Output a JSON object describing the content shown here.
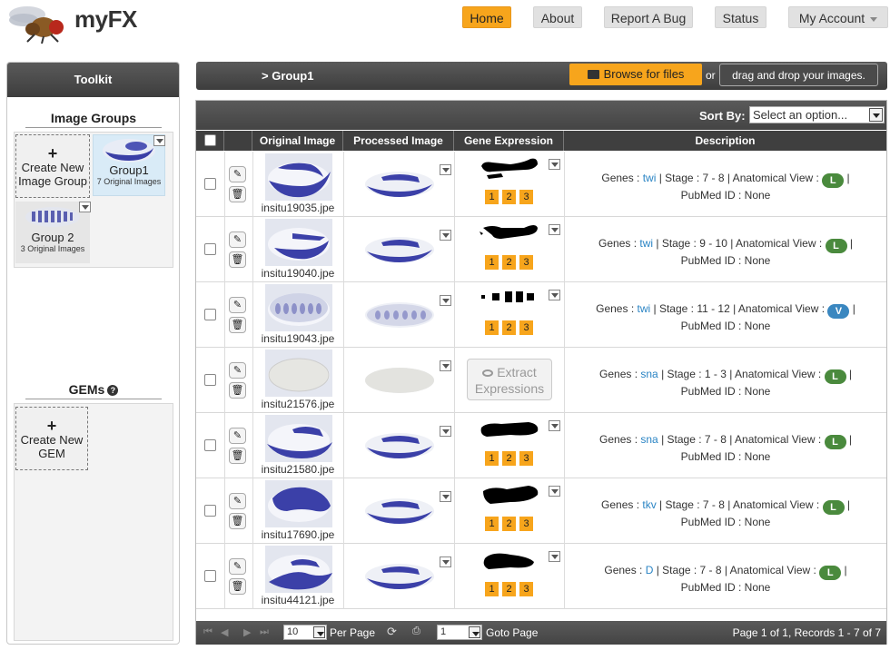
{
  "app": {
    "title": "myFX"
  },
  "nav": [
    {
      "label": "Home",
      "active": true
    },
    {
      "label": "About"
    },
    {
      "label": "Report A Bug"
    },
    {
      "label": "Status"
    },
    {
      "label": "My Account"
    }
  ],
  "toolkit": {
    "title": "Toolkit",
    "image_groups_title": "Image Groups",
    "create_group_label": "Create New Image Group",
    "groups": [
      {
        "name": "Group1",
        "sub": "7 Original Images",
        "selected": true
      },
      {
        "name": "Group 2",
        "sub": "3 Original Images",
        "selected": false
      }
    ],
    "gems_title": "GEMs",
    "create_gem_label": "Create New GEM"
  },
  "groupbar": {
    "breadcrumb": "> Group1",
    "browse_label": "Browse for files",
    "or_label": "or",
    "drag_label": "drag and drop your images."
  },
  "grid": {
    "sort_label": "Sort By:",
    "sort_placeholder": "Select an option...",
    "columns": [
      "Original Image",
      "Processed Image",
      "Gene Expression",
      "Description"
    ],
    "rows": [
      {
        "file": "insitu19035.jpe",
        "gene": "twi",
        "stage": "7 - 8",
        "view": "L",
        "pubmed": "None",
        "has_expression": true
      },
      {
        "file": "insitu19040.jpe",
        "gene": "twi",
        "stage": "9 - 10",
        "view": "L",
        "pubmed": "None",
        "has_expression": true
      },
      {
        "file": "insitu19043.jpe",
        "gene": "twi",
        "stage": "11 - 12",
        "view": "V",
        "pubmed": "None",
        "has_expression": true
      },
      {
        "file": "insitu21576.jpe",
        "gene": "sna",
        "stage": "1 - 3",
        "view": "L",
        "pubmed": "None",
        "has_expression": false
      },
      {
        "file": "insitu21580.jpe",
        "gene": "sna",
        "stage": "7 - 8",
        "view": "L",
        "pubmed": "None",
        "has_expression": true
      },
      {
        "file": "insitu17690.jpe",
        "gene": "tkv",
        "stage": "7 - 8",
        "view": "L",
        "pubmed": "None",
        "has_expression": true
      },
      {
        "file": "insitu44121.jpe",
        "gene": "D",
        "stage": "7 - 8",
        "view": "L",
        "pubmed": "None",
        "has_expression": true
      }
    ],
    "label_genes": "Genes : ",
    "label_stage": " | Stage : ",
    "label_view": " | Anatomical View : ",
    "label_pubmed": "PubMed ID : ",
    "expression_buttons": [
      "1",
      "2",
      "3"
    ],
    "extract_label": "Extract Expressions"
  },
  "pager": {
    "per_page_value": "10",
    "per_page_label": "Per Page",
    "page_value": "1",
    "goto_label": "Goto Page",
    "summary": "Page 1 of 1, Records 1 - 7 of 7"
  },
  "colors": {
    "accent": "#f7a51c",
    "view_L": "#4a8a3d",
    "view_V": "#3a87c0",
    "gene_link": "#2a84c4"
  }
}
